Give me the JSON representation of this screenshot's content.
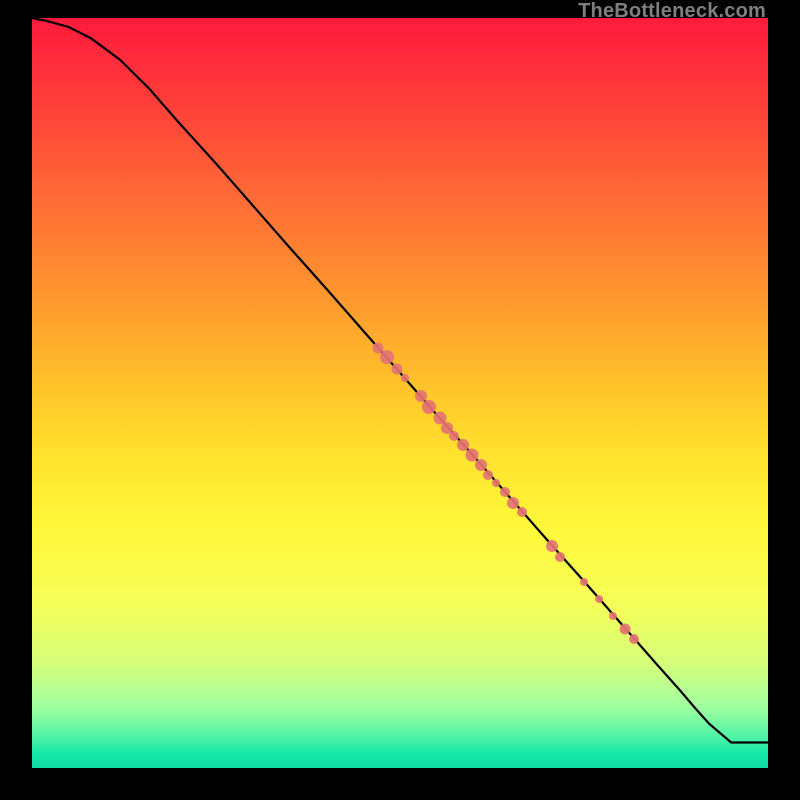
{
  "watermark": "TheBottleneck.com",
  "marker_color": "#e57373",
  "curve_color": "#000000",
  "chart_data": {
    "type": "line",
    "title": "",
    "xlabel": "",
    "ylabel": "",
    "xlim": [
      0,
      100
    ],
    "ylim": [
      0,
      100
    ],
    "series": [
      {
        "name": "curve",
        "x": [
          0,
          2,
          5,
          8,
          12,
          16,
          20,
          25,
          30,
          35,
          40,
          45,
          50,
          55,
          60,
          65,
          70,
          75,
          80,
          85,
          88,
          90,
          92,
          95,
          100
        ],
        "y": [
          100,
          99.6,
          98.8,
          97.3,
          94.4,
          90.5,
          86.0,
          80.6,
          75.0,
          69.4,
          63.9,
          58.3,
          52.7,
          47.1,
          41.6,
          36.0,
          30.4,
          24.9,
          19.3,
          13.7,
          10.4,
          8.1,
          5.9,
          3.4,
          3.4
        ]
      }
    ],
    "markers": [
      {
        "x": 47.0,
        "y": 56.0,
        "size": 11
      },
      {
        "x": 48.2,
        "y": 54.8,
        "size": 14
      },
      {
        "x": 49.6,
        "y": 53.2,
        "size": 11
      },
      {
        "x": 50.7,
        "y": 52.0,
        "size": 8
      },
      {
        "x": 52.8,
        "y": 49.6,
        "size": 12
      },
      {
        "x": 54.0,
        "y": 48.2,
        "size": 14
      },
      {
        "x": 55.4,
        "y": 46.7,
        "size": 13
      },
      {
        "x": 56.4,
        "y": 45.4,
        "size": 12
      },
      {
        "x": 57.4,
        "y": 44.3,
        "size": 10
      },
      {
        "x": 58.6,
        "y": 43.1,
        "size": 12
      },
      {
        "x": 59.8,
        "y": 41.8,
        "size": 13
      },
      {
        "x": 61.0,
        "y": 40.4,
        "size": 12
      },
      {
        "x": 62.0,
        "y": 39.1,
        "size": 10
      },
      {
        "x": 63.0,
        "y": 38.0,
        "size": 8
      },
      {
        "x": 64.2,
        "y": 36.8,
        "size": 10
      },
      {
        "x": 65.4,
        "y": 35.4,
        "size": 12
      },
      {
        "x": 66.6,
        "y": 34.2,
        "size": 10
      },
      {
        "x": 70.6,
        "y": 29.6,
        "size": 12
      },
      {
        "x": 71.8,
        "y": 28.2,
        "size": 10
      },
      {
        "x": 75.0,
        "y": 24.8,
        "size": 8
      },
      {
        "x": 77.0,
        "y": 22.6,
        "size": 8
      },
      {
        "x": 79.0,
        "y": 20.3,
        "size": 8
      },
      {
        "x": 80.6,
        "y": 18.6,
        "size": 11
      },
      {
        "x": 81.8,
        "y": 17.2,
        "size": 10
      }
    ]
  }
}
